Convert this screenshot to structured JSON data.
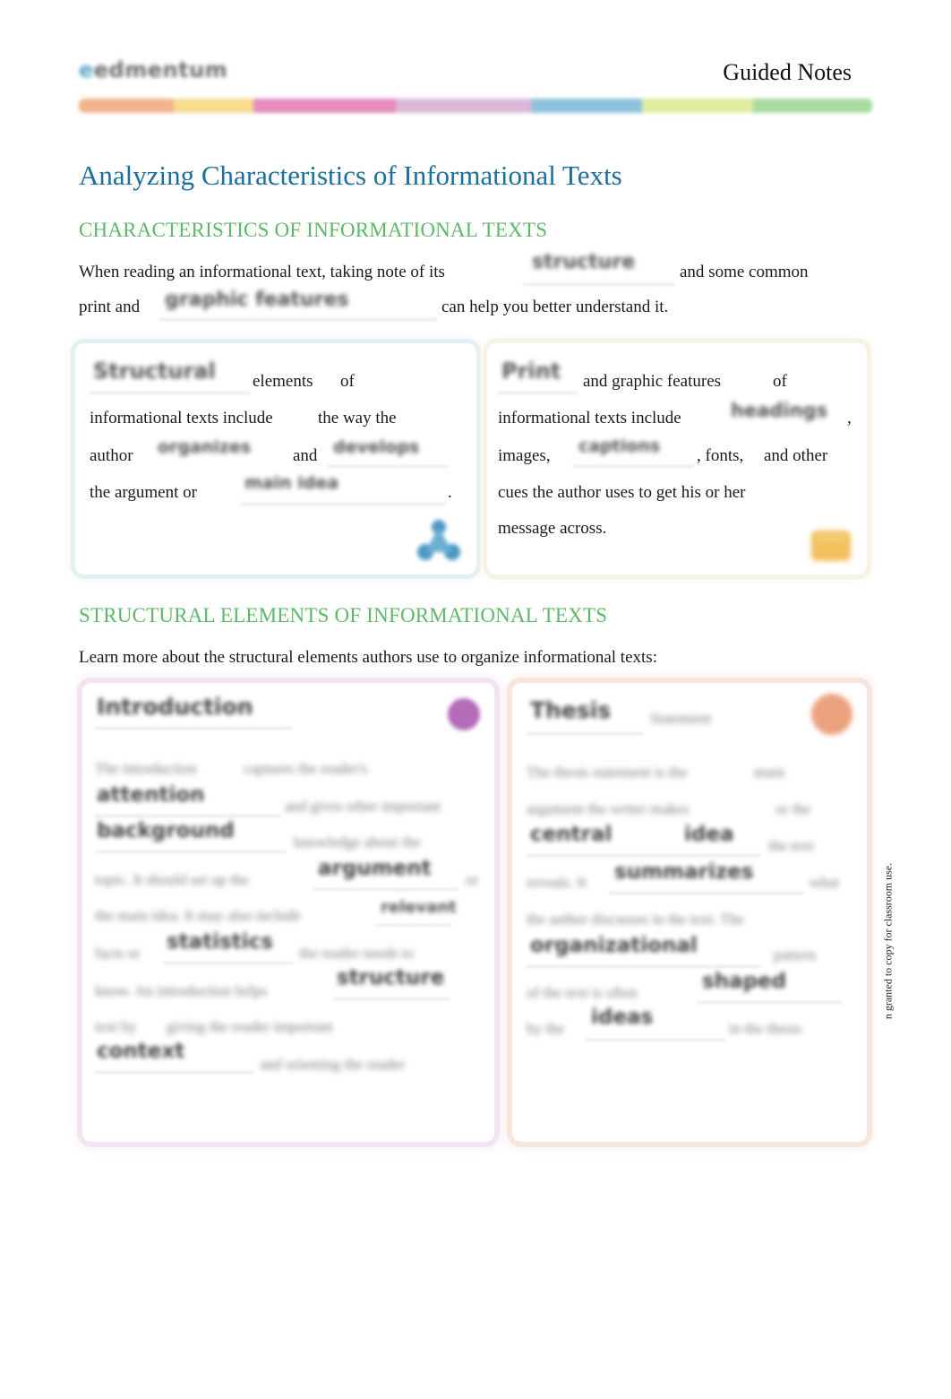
{
  "header": {
    "logo_text": "edmentum",
    "doc_type": "Guided Notes",
    "stripe_colors": [
      "#f2b48f",
      "#f6dc8c",
      "#e68dbd",
      "#dcb8d8",
      "#8ec3dd",
      "#e1ec9f",
      "#a9dba0"
    ]
  },
  "title": "Analyzing Characteristics of Informational Texts",
  "section1": {
    "heading": "CHARACTERISTICS OF INFORMATIONAL TEXTS",
    "line1_pre": "When reading an informational text, taking note of its",
    "blank1": "structure",
    "line1_post": "and some common",
    "line2_pre": "print and",
    "blank2": "graphic   features",
    "line2_post": "can help you better understand it."
  },
  "card_structural": {
    "blank_title": "Structural",
    "w_elements": "elements",
    "w_of": "of",
    "w_informational": "informational texts include",
    "w_theway": "the way the",
    "w_author": "author",
    "blank_organizes": "organizes",
    "w_and": "and",
    "blank_develops": "develops",
    "w_argument": "the argument or",
    "blank_mainidea": "main   idea",
    "w_period": ".",
    "icon": "hierarchy-icon",
    "accent": "#4a98c4"
  },
  "card_print": {
    "blank_title": "Print",
    "w_and_graphic": "and graphic features",
    "w_of": "of",
    "w_informational": "informational texts include",
    "blank_headings": "headings",
    "w_comma": ",",
    "w_images": "images,",
    "blank_captions": "captions",
    "w_fonts": ", fonts,",
    "w_and_other": "and other",
    "w_cues": "cues the author uses to get his or her",
    "w_message": "message across.",
    "icon": "document-icon",
    "accent": "#f2c15e"
  },
  "section2": {
    "heading": "STRUCTURAL ELEMENTS OF INFORMATIONAL TEXTS",
    "intro": "Learn more about the structural elements authors use to organize informational texts:"
  },
  "card_intro": {
    "blank_title": "Introduction",
    "lines": [
      [
        "The introduction",
        "captures the reader's"
      ],
      [
        "attention",
        "and gives other important"
      ],
      [
        "background",
        "knowledge about the"
      ],
      [
        "topic.  It should set up the",
        "argument",
        "or"
      ],
      [
        "the main idea. It may also include",
        "relevant"
      ],
      [
        "facts or",
        "statistics",
        "the reader needs to"
      ],
      [
        "know. An introduction helps",
        "structure"
      ],
      [
        "text by",
        "giving the reader important"
      ],
      [
        "context",
        "and  orienting the reader"
      ]
    ],
    "icon": "magnifier-icon",
    "accent": "#b46bb8"
  },
  "card_thesis": {
    "blank_title": "Thesis",
    "subtitle": "Statement",
    "lines": [
      [
        "The thesis statement is the",
        "main"
      ],
      [
        "argument the writer makes",
        "or the"
      ],
      [
        "central",
        "idea",
        "the text"
      ],
      [
        "reveals.  It",
        "summarizes",
        "what"
      ],
      [
        "the author discusses in the text. The"
      ],
      [
        "organizational",
        "pattern"
      ],
      [
        "of the text is often",
        "shaped"
      ],
      [
        "by the",
        "ideas",
        "in the thesis"
      ]
    ],
    "icon": "target-icon",
    "accent": "#eca27e"
  },
  "footer": {
    "side_note": "n granted to copy for classroom use."
  }
}
